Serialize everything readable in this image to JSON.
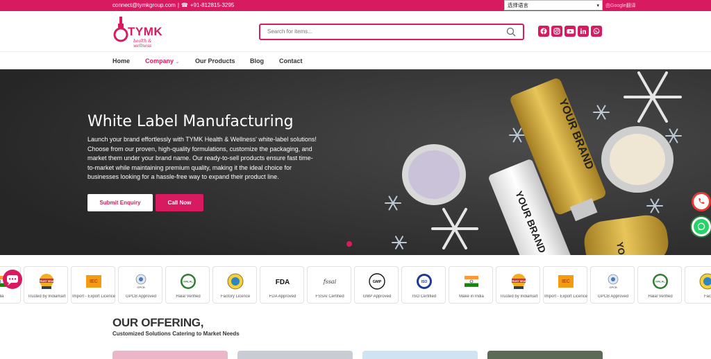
{
  "topbar": {
    "email": "connect@tymkgroup.com",
    "separator": "|",
    "phone": "+91-812815-3295",
    "language_select": "选择语言",
    "translate_text": "由Google翻译"
  },
  "logo": {
    "word": "TYMK",
    "tagline": "health & wellness"
  },
  "search": {
    "placeholder": "Search for items..."
  },
  "socials": [
    "facebook-icon",
    "instagram-icon",
    "youtube-icon",
    "linkedin-icon",
    "whatsapp-icon"
  ],
  "nav": {
    "items": [
      {
        "label": "Home"
      },
      {
        "label": "Company"
      },
      {
        "label": "Our Products"
      },
      {
        "label": "Blog"
      },
      {
        "label": "Contact"
      }
    ],
    "active": "Company"
  },
  "hero": {
    "title": "White Label Manufacturing",
    "description": "Launch your brand effortlessly with TYMK Health & Wellness' white-label solutions! Choose from our proven, high-quality formulations, customize the packaging, and market them under your brand name. Our ready-to-sell products ensure fast time-to-market while maintaining premium quality, making it the ideal choice for businesses looking for a hassle-free way to expand their product line.",
    "enquiry_button": "Submit Enquiry",
    "call_button": "Call Now",
    "product_text_1": "YOUR BRAND",
    "product_text_2": "YOUR BRAND",
    "product_text_3": "YOU"
  },
  "certifications": [
    {
      "label": "India",
      "icon": "flag-icon"
    },
    {
      "label": "Trusted by Indiamart",
      "icon": "trust-seal-icon",
      "badge": "TRUST SEAL"
    },
    {
      "label": "Import - Export Licence",
      "icon": "iec-icon",
      "badge": "IEC"
    },
    {
      "label": "GPCB Approved",
      "icon": "gpcb-icon",
      "badge": "GPCB"
    },
    {
      "label": "Halal Verified",
      "icon": "halal-icon",
      "badge": "HALAL"
    },
    {
      "label": "Factory Licence",
      "icon": "factory-licence-icon"
    },
    {
      "label": "FDA Approved",
      "icon": "fda-icon",
      "badge": "FDA"
    },
    {
      "label": "FSSAI Certified",
      "icon": "fssai-icon",
      "badge": "fssai"
    },
    {
      "label": "GMP Approved",
      "icon": "gmp-icon",
      "badge": "GMP"
    },
    {
      "label": "ISO Certified",
      "icon": "iso-icon",
      "badge": "ISO"
    },
    {
      "label": "Make in India",
      "icon": "make-in-india-icon"
    },
    {
      "label": "Trusted by Indiamart",
      "icon": "trust-seal-icon",
      "badge": "TRUST SEAL"
    },
    {
      "label": "Import - Export Licence",
      "icon": "iec-icon",
      "badge": "IEC"
    },
    {
      "label": "GPCB Approved",
      "icon": "gpcb-icon",
      "badge": "GPCB"
    },
    {
      "label": "Halal Verified",
      "icon": "halal-icon",
      "badge": "HALAL"
    },
    {
      "label": "Fac",
      "icon": "factory-licence-icon"
    }
  ],
  "offering": {
    "title": "OUR OFFERING,",
    "subtitle": "Customized Solutions Catering to Market Needs"
  },
  "colors": {
    "brand": "#d81b60",
    "dark": "#2f2f2f",
    "gold": "#c9a23a",
    "whatsapp": "#25d366",
    "phone": "#e53935"
  }
}
